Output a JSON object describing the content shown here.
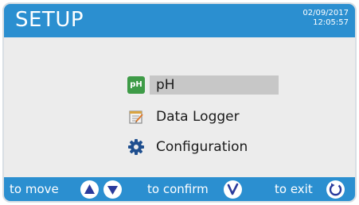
{
  "header": {
    "title": "SETUP",
    "date": "02/09/2017",
    "time": "12:05:57"
  },
  "menu": {
    "items": [
      {
        "label": "pH",
        "icon": "ph-icon",
        "icon_text": "pH",
        "selected": true
      },
      {
        "label": "Data Logger",
        "icon": "notepad-icon",
        "selected": false
      },
      {
        "label": "Configuration",
        "icon": "gear-icon",
        "selected": false
      }
    ]
  },
  "footer": {
    "move_label": "to move",
    "confirm_label": "to confirm",
    "exit_label": "to exit"
  },
  "colors": {
    "accent": "#2b8fd0",
    "background": "#ececec",
    "selection": "#c7c7c7"
  }
}
